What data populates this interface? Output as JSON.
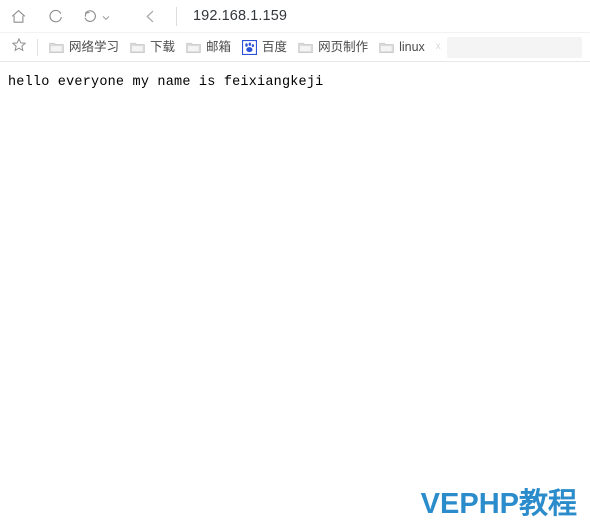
{
  "browser": {
    "nav": {
      "home_label": "Home",
      "refresh_label": "Refresh",
      "history_label": "History",
      "back_label": "Back",
      "icons": [
        "home-icon",
        "refresh-icon",
        "undo-history-icon",
        "back-chevron-icon"
      ]
    },
    "address": {
      "url": "192.168.1.159",
      "placeholder": "192.168.1.159"
    },
    "bookmarks": {
      "star_icon": "star-icon",
      "overflow_glyph": "x",
      "items": [
        {
          "label": "网络学习",
          "icon": "folder-icon",
          "type": "folder"
        },
        {
          "label": "下载",
          "icon": "folder-icon",
          "type": "folder"
        },
        {
          "label": "邮箱",
          "icon": "folder-icon",
          "type": "folder"
        },
        {
          "label": "百度",
          "icon": "baidu-paw-icon",
          "type": "site"
        },
        {
          "label": "网页制作",
          "icon": "folder-icon",
          "type": "folder"
        },
        {
          "label": "linux",
          "icon": "folder-icon",
          "type": "folder"
        }
      ]
    }
  },
  "page": {
    "body_text": "hello everyone my name is feixiangkeji"
  },
  "watermark": {
    "text": "VEPHP教程",
    "color": "#2b8ccc"
  },
  "colors": {
    "chrome_background": "#ffffff",
    "text_primary": "#33363b",
    "bookmark_label": "#4a4a4a",
    "icon_stroke": "#8a8a8a",
    "divider": "#e8e8e8",
    "baidu_blue": "#2b52d8",
    "folder_grey": "#d3d3d3"
  }
}
